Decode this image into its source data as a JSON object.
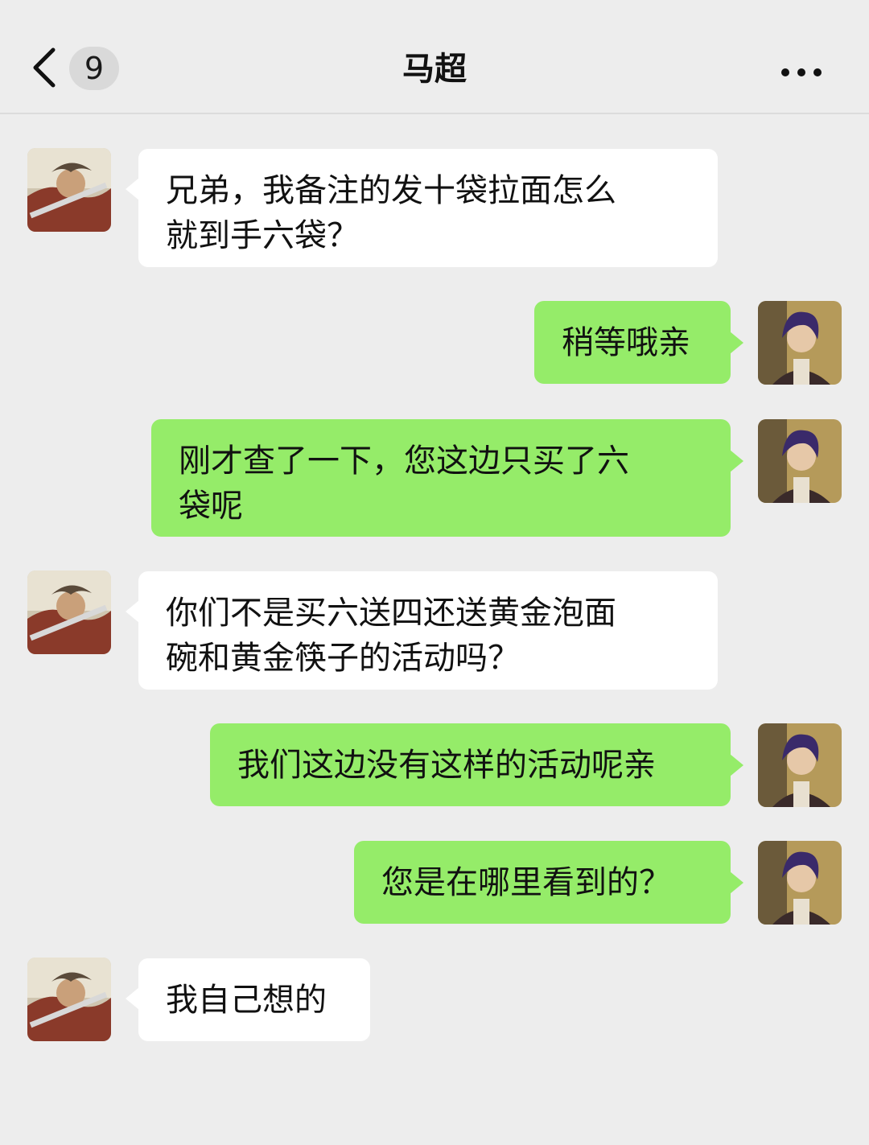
{
  "header": {
    "title": "马超",
    "unread_count": "9"
  },
  "messages": [
    {
      "side": "in",
      "text": "兄弟，我备注的发十袋拉面怎么\n就到手六袋？"
    },
    {
      "side": "out",
      "text": "稍等哦亲"
    },
    {
      "side": "out",
      "text": "刚才查了一下，您这边只买了六\n袋呢"
    },
    {
      "side": "in",
      "text": "你们不是买六送四还送黄金泡面\n碗和黄金筷子的活动吗？"
    },
    {
      "side": "out",
      "text": "我们这边没有这样的活动呢亲"
    },
    {
      "side": "out",
      "text": "您是在哪里看到的？"
    },
    {
      "side": "in",
      "text": "我自己想的"
    }
  ]
}
